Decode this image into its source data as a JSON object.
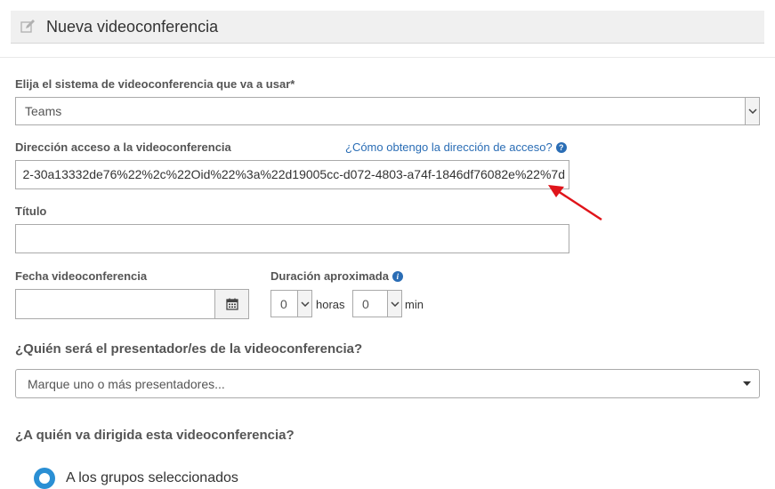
{
  "header": {
    "title": "Nueva videoconferencia",
    "icon": "edit-icon"
  },
  "system": {
    "label": "Elija el sistema de videoconferencia que va a usar*",
    "selected": "Teams"
  },
  "address": {
    "label": "Dirección acceso a la videoconferencia",
    "help_link": "¿Cómo obtengo la dirección de acceso?",
    "value": "2-30a13332de76%22%2c%22Oid%22%3a%22d19005cc-d072-4803-a74f-1846df76082e%22%7d"
  },
  "titulo": {
    "label": "Título",
    "value": ""
  },
  "fecha": {
    "label": "Fecha videoconferencia",
    "value": ""
  },
  "duracion": {
    "label": "Duración aproximada",
    "hours_value": "0",
    "hours_unit": "horas",
    "minutes_value": "0",
    "minutes_unit": "min"
  },
  "presenter": {
    "question": "¿Quién será el presentador/es de la videoconferencia?",
    "placeholder": "Marque uno o más presentadores..."
  },
  "audience": {
    "question": "¿A quién va dirigida esta videoconferencia?",
    "option_label": "A los grupos seleccionados"
  },
  "colors": {
    "link": "#2a6db5",
    "annotation_arrow": "#e0141a",
    "radio": "#2a8fd4"
  }
}
